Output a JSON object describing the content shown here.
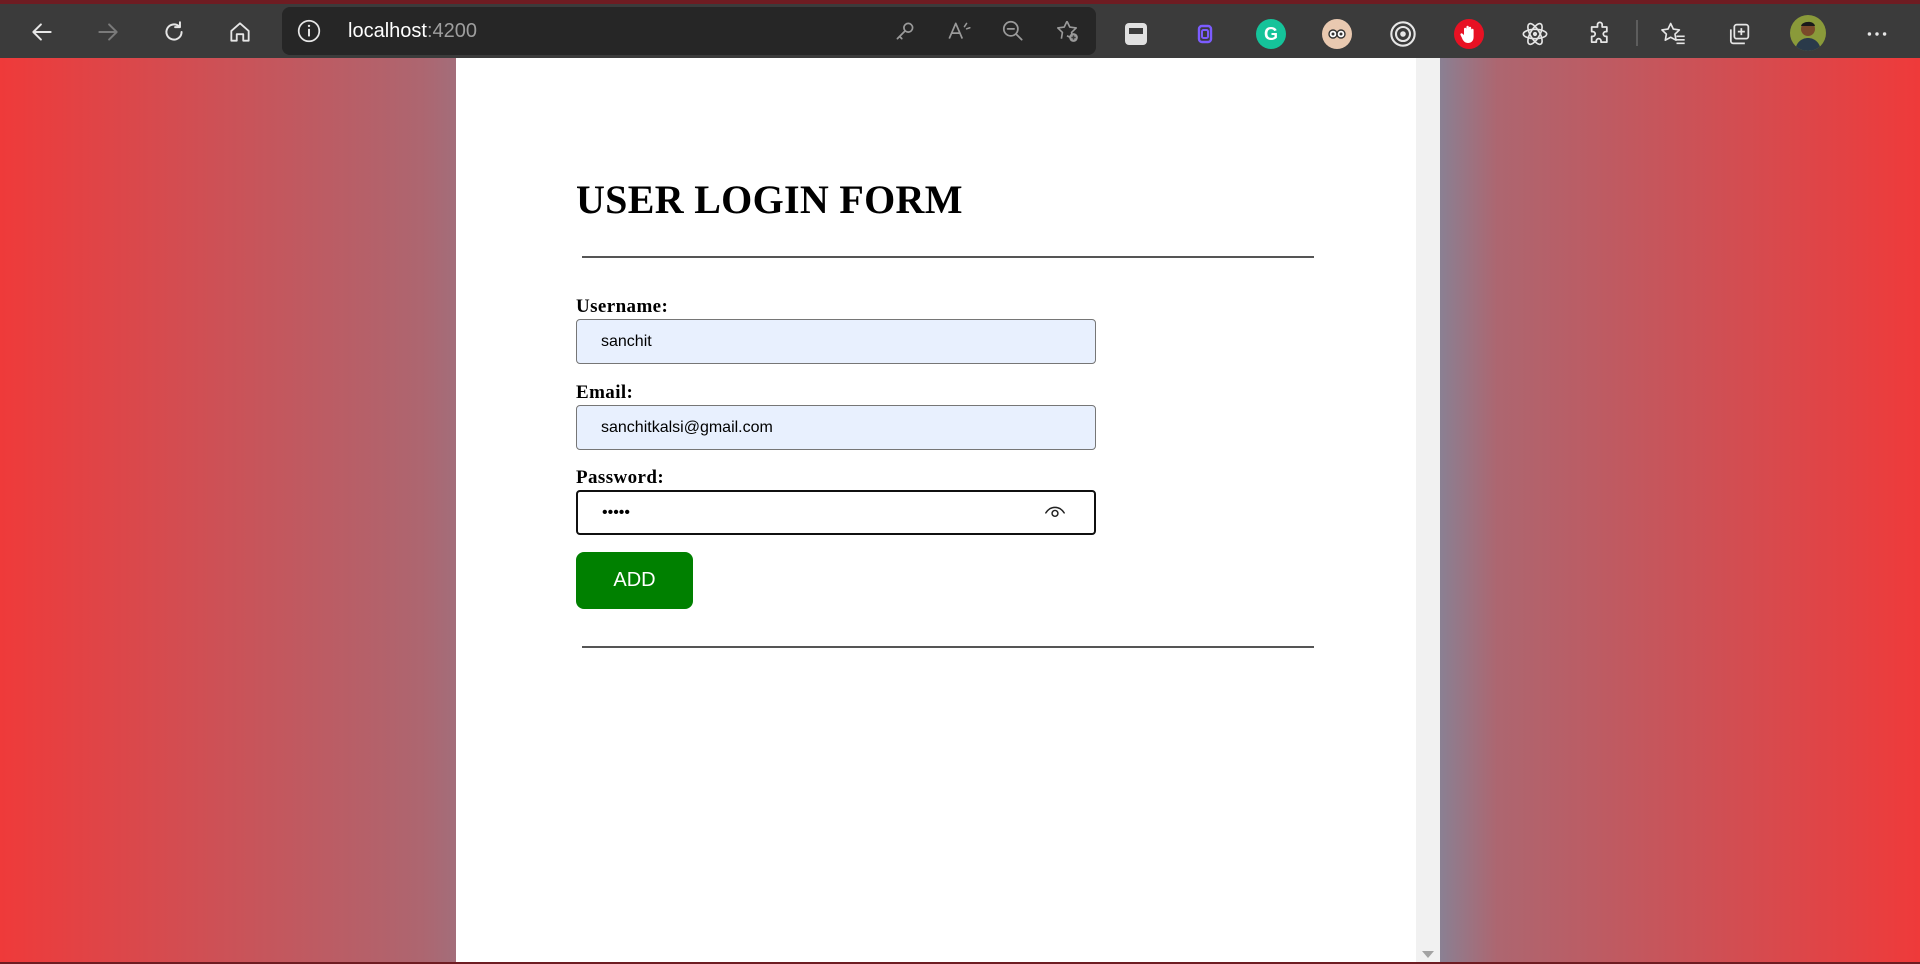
{
  "browser": {
    "address": {
      "host": "localhost",
      "port": ":4200"
    },
    "toolbar_icons": [
      "back-icon",
      "forward-icon",
      "refresh-icon",
      "home-icon",
      "info-icon",
      "key-icon",
      "read-aloud-icon",
      "zoom-out-icon",
      "add-favorite-icon"
    ],
    "extensions": [
      "sidebar-extension-icon",
      "clipboard-extension-icon",
      "grammarly-extension-icon",
      "face-extension-icon",
      "target-extension-icon",
      "hand-extension-icon",
      "react-extension-icon",
      "extensions-icon",
      "favorites-icon",
      "collections-icon",
      "profile-avatar",
      "more-menu-icon"
    ],
    "colors": {
      "grammarly": "#15c39a",
      "clipboard": "#7c5cff",
      "hand": "#e81123"
    }
  },
  "form": {
    "title": "USER LOGIN FORM",
    "username_label": "Username:",
    "username_value": "sanchit",
    "email_label": "Email:",
    "email_value": "sanchitkalsi@gmail.com",
    "password_label": "Password:",
    "password_value": "•••••",
    "add_label": "ADD"
  },
  "colors": {
    "add_button": "#008000",
    "autofill_bg": "#e8f0fe"
  }
}
